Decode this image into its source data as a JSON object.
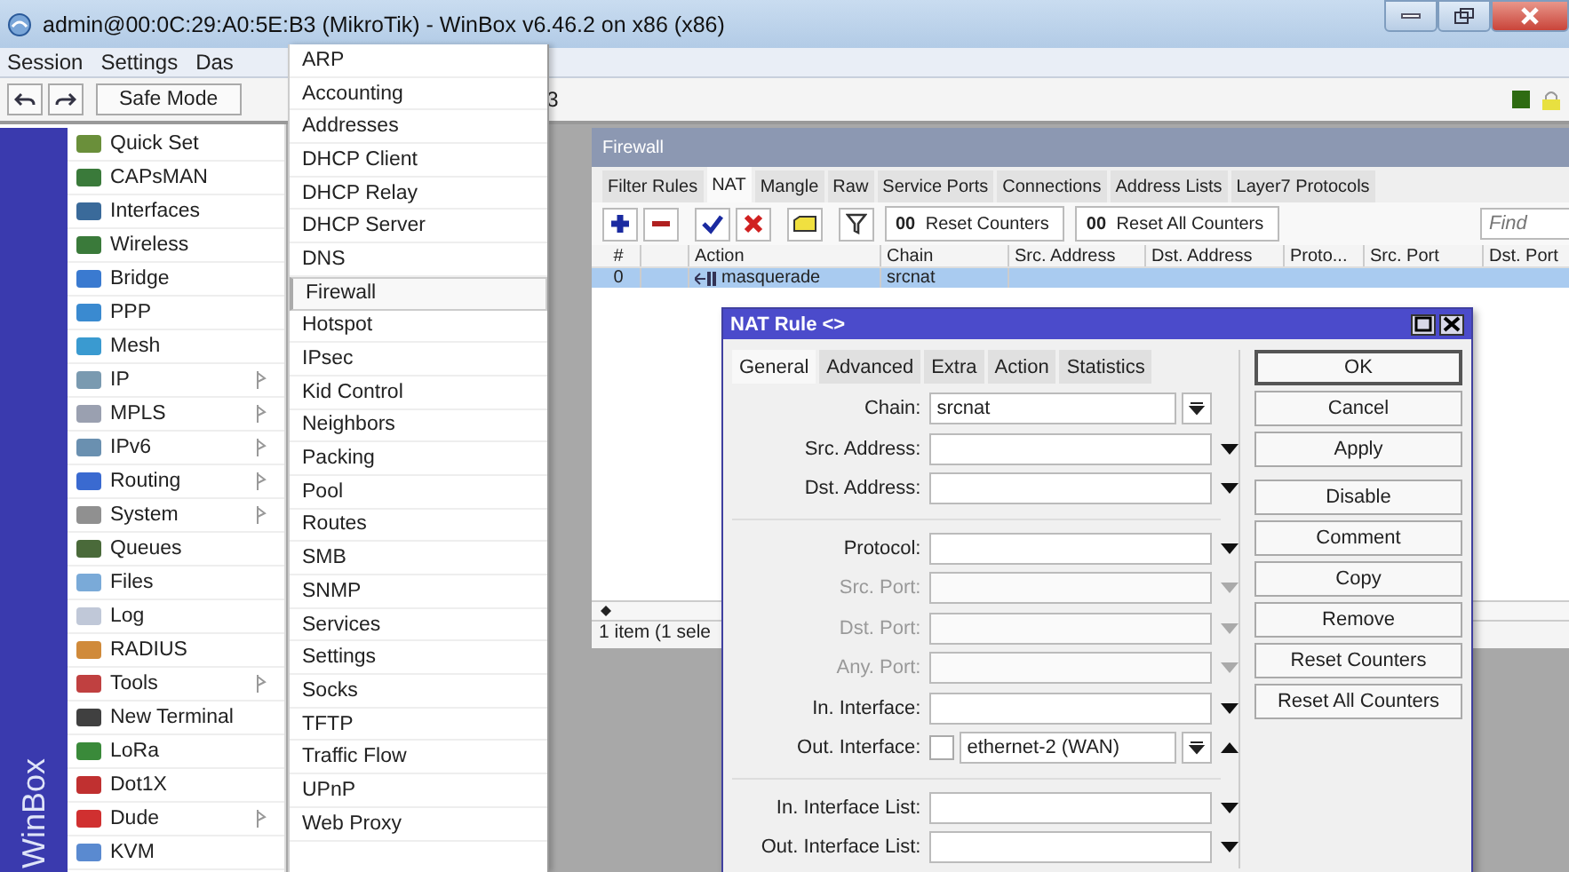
{
  "window": {
    "title": "admin@00:0C:29:A0:5E:B3 (MikroTik) - WinBox v6.46.2 on x86 (x86)"
  },
  "menu_bar": [
    "Session",
    "Settings",
    "Das"
  ],
  "toolbar": {
    "safe_mode": "Safe Mode",
    "session_tail": "3"
  },
  "sidebar": {
    "brand": "WinBox",
    "items": [
      {
        "label": "Quick Set",
        "has_submenu": false
      },
      {
        "label": "CAPsMAN",
        "has_submenu": false
      },
      {
        "label": "Interfaces",
        "has_submenu": false
      },
      {
        "label": "Wireless",
        "has_submenu": false
      },
      {
        "label": "Bridge",
        "has_submenu": false
      },
      {
        "label": "PPP",
        "has_submenu": false
      },
      {
        "label": "Mesh",
        "has_submenu": false
      },
      {
        "label": "IP",
        "has_submenu": true
      },
      {
        "label": "MPLS",
        "has_submenu": true
      },
      {
        "label": "IPv6",
        "has_submenu": true
      },
      {
        "label": "Routing",
        "has_submenu": true
      },
      {
        "label": "System",
        "has_submenu": true
      },
      {
        "label": "Queues",
        "has_submenu": false
      },
      {
        "label": "Files",
        "has_submenu": false
      },
      {
        "label": "Log",
        "has_submenu": false
      },
      {
        "label": "RADIUS",
        "has_submenu": false
      },
      {
        "label": "Tools",
        "has_submenu": true
      },
      {
        "label": "New Terminal",
        "has_submenu": false
      },
      {
        "label": "LoRa",
        "has_submenu": false
      },
      {
        "label": "Dot1X",
        "has_submenu": false
      },
      {
        "label": "Dude",
        "has_submenu": true
      },
      {
        "label": "KVM",
        "has_submenu": false
      }
    ]
  },
  "submenu": {
    "items": [
      {
        "label": "ARP",
        "selected": false
      },
      {
        "label": "Accounting",
        "selected": false
      },
      {
        "label": "Addresses",
        "selected": false
      },
      {
        "label": "DHCP Client",
        "selected": false
      },
      {
        "label": "DHCP Relay",
        "selected": false
      },
      {
        "label": "DHCP Server",
        "selected": false
      },
      {
        "label": "DNS",
        "selected": false
      },
      {
        "label": "Firewall",
        "selected": true
      },
      {
        "label": "Hotspot",
        "selected": false
      },
      {
        "label": "IPsec",
        "selected": false
      },
      {
        "label": "Kid Control",
        "selected": false
      },
      {
        "label": "Neighbors",
        "selected": false
      },
      {
        "label": "Packing",
        "selected": false
      },
      {
        "label": "Pool",
        "selected": false
      },
      {
        "label": "Routes",
        "selected": false
      },
      {
        "label": "SMB",
        "selected": false
      },
      {
        "label": "SNMP",
        "selected": false
      },
      {
        "label": "Services",
        "selected": false
      },
      {
        "label": "Settings",
        "selected": false
      },
      {
        "label": "Socks",
        "selected": false
      },
      {
        "label": "TFTP",
        "selected": false
      },
      {
        "label": "Traffic Flow",
        "selected": false
      },
      {
        "label": "UPnP",
        "selected": false
      },
      {
        "label": "Web Proxy",
        "selected": false
      }
    ]
  },
  "firewall": {
    "title": "Firewall",
    "tabs": [
      {
        "label": "Filter Rules",
        "selected": false
      },
      {
        "label": "NAT",
        "selected": true
      },
      {
        "label": "Mangle",
        "selected": false
      },
      {
        "label": "Raw",
        "selected": false
      },
      {
        "label": "Service Ports",
        "selected": false
      },
      {
        "label": "Connections",
        "selected": false
      },
      {
        "label": "Address Lists",
        "selected": false
      },
      {
        "label": "Layer7 Protocols",
        "selected": false
      }
    ],
    "counter_buttons": [
      {
        "badge": "00",
        "label": "Reset Counters"
      },
      {
        "badge": "00",
        "label": "Reset All Counters"
      }
    ],
    "find": {
      "placeholder": "Find"
    },
    "columns": [
      "#",
      "Action",
      "Chain",
      "Src. Address",
      "Dst. Address",
      "Proto...",
      "Src. Port",
      "Dst. Port"
    ],
    "rows": [
      {
        "selected": true,
        "number": "0",
        "action": "masquerade",
        "chain": "srcnat"
      }
    ],
    "status": "1 item (1 sele"
  },
  "dialog": {
    "title": "NAT Rule <>",
    "tabs": [
      {
        "label": "General",
        "selected": true
      },
      {
        "label": "Advanced",
        "selected": false
      },
      {
        "label": "Extra",
        "selected": false
      },
      {
        "label": "Action",
        "selected": false
      },
      {
        "label": "Statistics",
        "selected": false
      }
    ],
    "field_groups": [
      [
        {
          "kind": "dropdown",
          "label": "Chain:",
          "value": "srcnat",
          "disabled": false
        },
        {
          "kind": "collapsed",
          "label": "Src. Address:",
          "disabled": false
        },
        {
          "kind": "collapsed",
          "label": "Dst. Address:",
          "disabled": false
        }
      ],
      [
        {
          "kind": "collapsed",
          "label": "Protocol:",
          "disabled": false
        },
        {
          "kind": "collapsed",
          "label": "Src. Port:",
          "disabled": true
        },
        {
          "kind": "collapsed",
          "label": "Dst. Port:",
          "disabled": true
        },
        {
          "kind": "collapsed",
          "label": "Any. Port:",
          "disabled": true
        },
        {
          "kind": "collapsed",
          "label": "In. Interface:",
          "disabled": false
        },
        {
          "kind": "expanded-dropdown",
          "label": "Out. Interface:",
          "value": "ethernet-2 (WAN)",
          "checkbox": {
            "checked": false
          },
          "disabled": false
        }
      ],
      [
        {
          "kind": "collapsed",
          "label": "In. Interface List:",
          "disabled": false
        },
        {
          "kind": "collapsed",
          "label": "Out. Interface List:",
          "disabled": false
        }
      ]
    ],
    "button_groups": [
      [
        {
          "label": "OK",
          "default": true
        },
        {
          "label": "Cancel",
          "default": false
        },
        {
          "label": "Apply",
          "default": false
        }
      ],
      [
        {
          "label": "Disable",
          "default": false
        },
        {
          "label": "Comment",
          "default": false
        },
        {
          "label": "Copy",
          "default": false
        },
        {
          "label": "Remove",
          "default": false
        },
        {
          "label": "Reset Counters",
          "default": false
        },
        {
          "label": "Reset All Counters",
          "default": false
        }
      ]
    ]
  }
}
